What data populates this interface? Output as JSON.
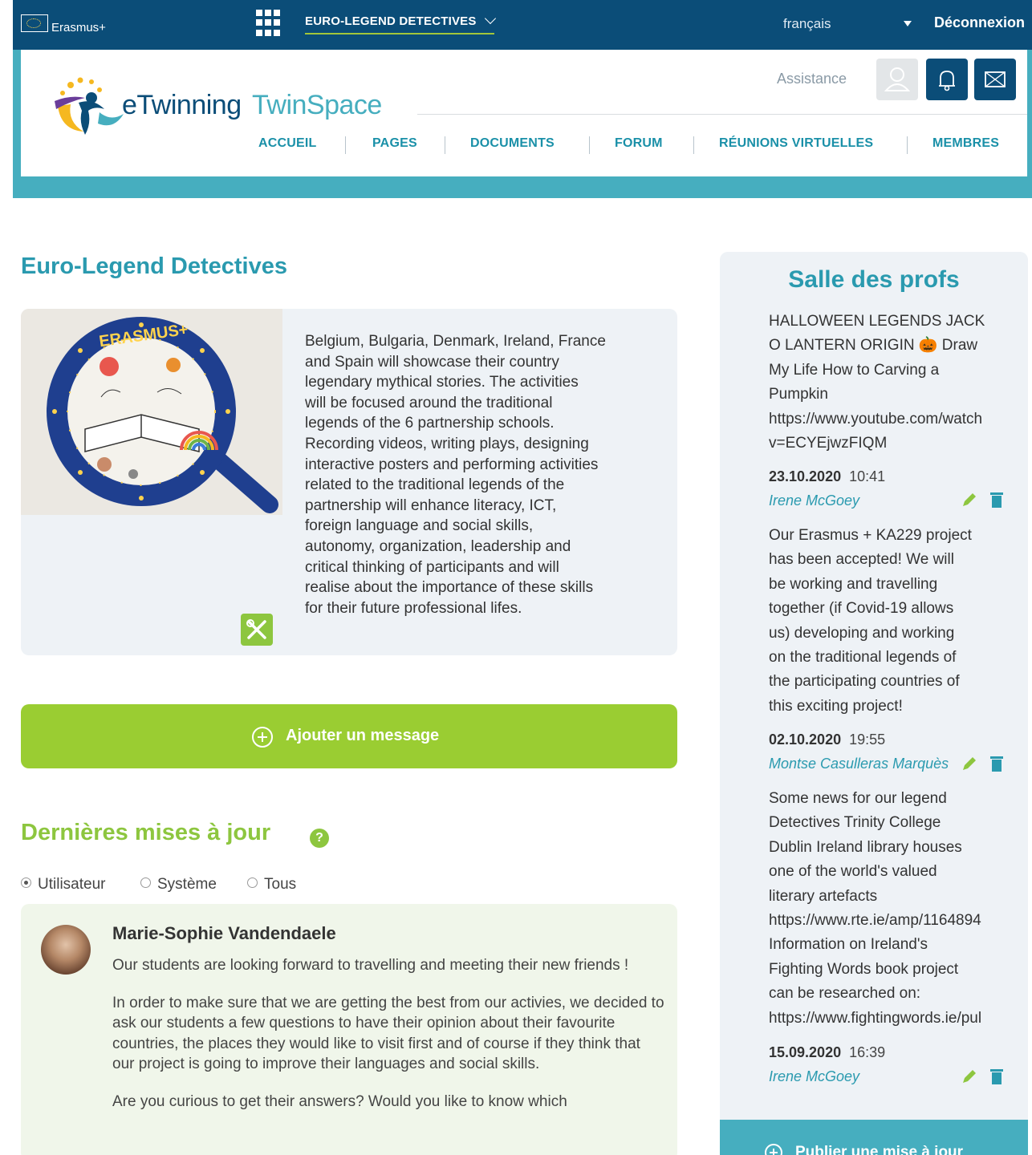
{
  "topbar": {
    "brand": "Erasmus+",
    "project_menu": "EURO-LEGEND DETECTIVES",
    "language": "français",
    "logout": "Déconnexion"
  },
  "header": {
    "logo_e": "eTwinning",
    "logo_twin": "TwinSpace",
    "assistance": "Assistance",
    "nav": [
      "ACCUEIL",
      "PAGES",
      "DOCUMENTS",
      "FORUM",
      "RÉUNIONS VIRTUELLES",
      "MEMBRES"
    ]
  },
  "main": {
    "title": "Euro-Legend Detectives",
    "project_image_text": "ERASMUS+",
    "description_lines": [
      "Belgium, Bulgaria, Denmark, Ireland, France",
      "and Spain will showcase their country",
      "legendary mythical stories. The activities",
      "will be focused around the traditional",
      "legends of the 6 partnership schools.",
      "Recording videos, writing plays, designing",
      "interactive posters and performing activities",
      "related to the traditional legends of the",
      "partnership will enhance literacy, ICT,",
      "foreign language and social skills,",
      "autonomy, organization, leadership and",
      "critical thinking of participants and will",
      "realise about the importance of these skills",
      "for their future professional lifes."
    ],
    "add_message": "Ajouter un message",
    "updates_title": "Dernières mises à jour",
    "help": "?",
    "filters": [
      "Utilisateur",
      "Système",
      "Tous"
    ],
    "post": {
      "author": "Marie-Sophie Vandendaele",
      "p1": "Our students are looking forward to travelling and meeting their new friends !",
      "p2": "In order to make sure that we are getting the best from our activies, we decided to ask our students a few questions to have their opinion about their favourite countries, the places they would like to visit first and of course if they think that our project is going to improve their languages and social skills.",
      "p3": "Are you curious to get their answers? Would you like to know which"
    }
  },
  "sidebar": {
    "title": "Salle des profs",
    "entries": [
      {
        "lines": [
          "HALLOWEEN LEGENDS JACK",
          "O LANTERN ORIGIN 🎃 Draw",
          "My Life How to Carving a",
          "Pumpkin",
          "https://www.youtube.com/watch",
          "v=ECYEjwzFIQM"
        ],
        "date": "23.10.2020",
        "time": "10:41",
        "author": "Irene McGoey"
      },
      {
        "lines": [
          "Our Erasmus + KA229 project",
          "has been accepted! We will",
          "be working and travelling",
          "together (if Covid-19 allows",
          "us) developing and working",
          "on the traditional legends of",
          "the participating countries of",
          "this exciting project!"
        ],
        "date": "02.10.2020",
        "time": "19:55",
        "author": "Montse Casulleras Marquès"
      },
      {
        "lines": [
          "Some news for our legend",
          "Detectives Trinity College",
          "Dublin Ireland library houses",
          "one of the world's valued",
          "literary artefacts",
          "https://www.rte.ie/amp/1164894",
          "Information on Ireland's",
          "Fighting Words book project",
          "can be researched on:",
          "https://www.fightingwords.ie/pul"
        ],
        "date": "15.09.2020",
        "time": "16:39",
        "author": "Irene McGoey"
      }
    ],
    "publish": "Publier une mise à jour"
  },
  "colors": {
    "topbar": "#0b4d78",
    "teal": "#2a9aaf",
    "green": "#8dc63f",
    "card_bg": "#eef2f6"
  },
  "icons": [
    "erasmus-flag-icon",
    "apps-grid-icon",
    "chevron-down-icon",
    "caret-down-icon",
    "user-icon",
    "bell-icon",
    "mail-icon",
    "tools-icon",
    "plus-circle-icon",
    "help-icon",
    "pencil-icon",
    "trash-icon"
  ]
}
